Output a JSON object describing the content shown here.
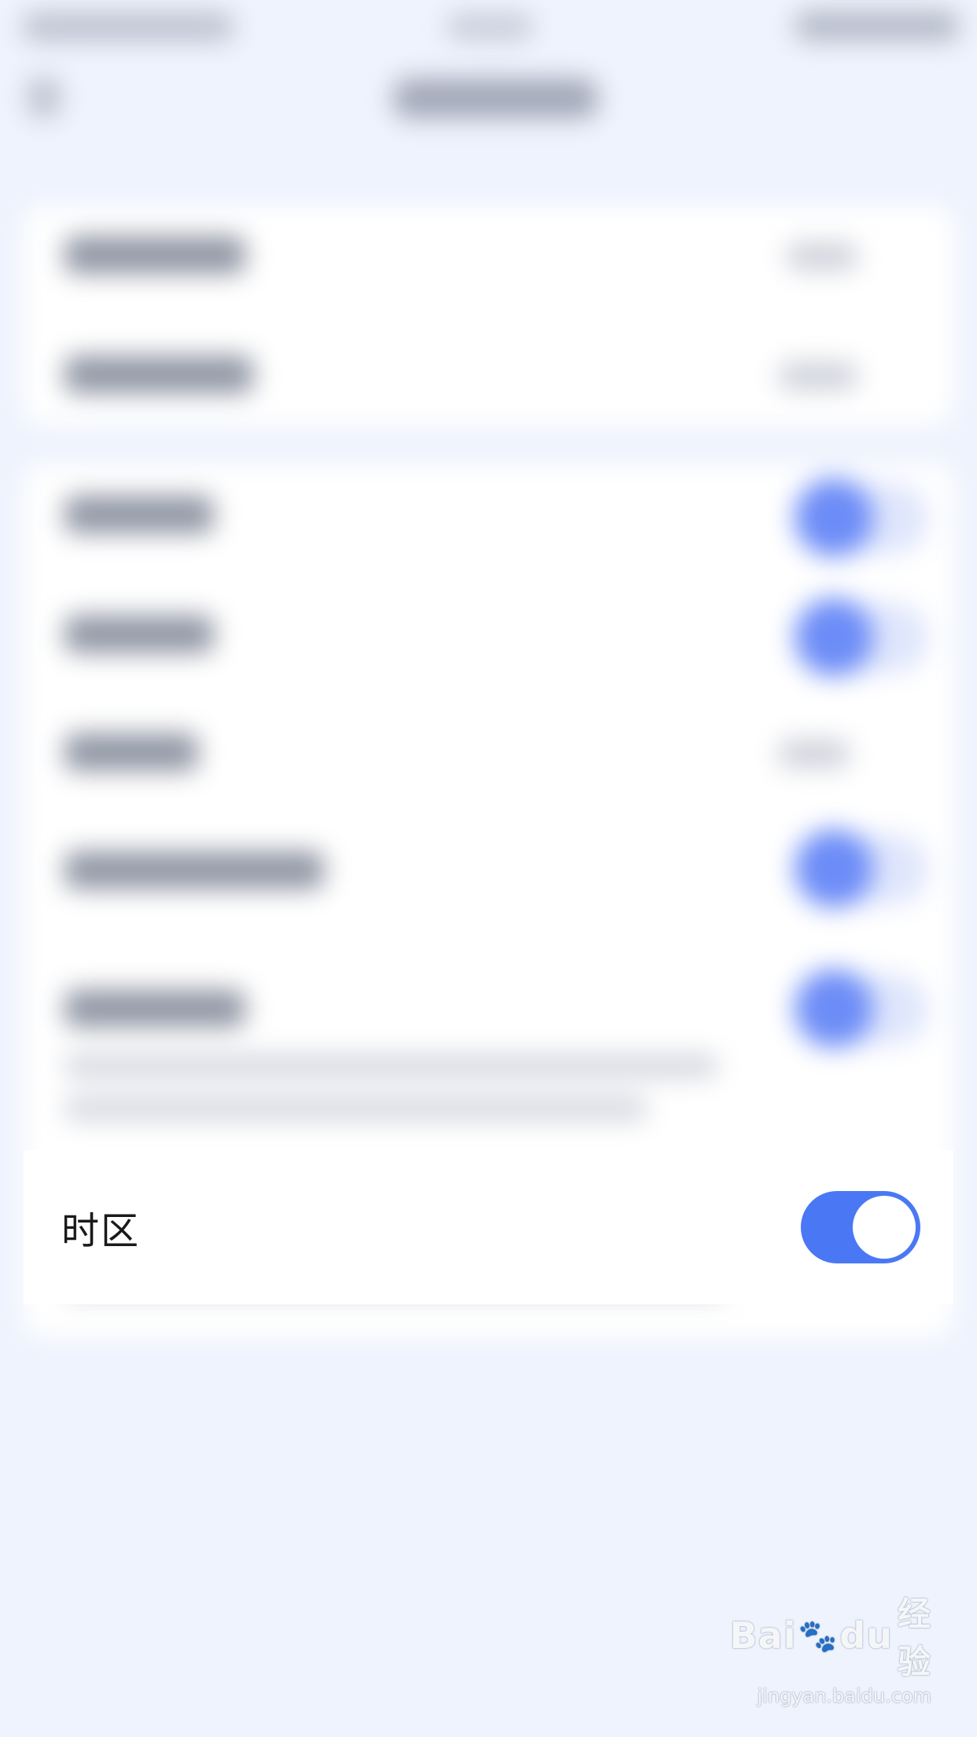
{
  "setting_row": {
    "label": "时区",
    "toggle_on": true
  },
  "colors": {
    "background": "#eff3fd",
    "card": "#ffffff",
    "toggle_on": "#4a78f5",
    "text": "#1a1a1a"
  },
  "icons": {
    "watermark_logo": "baidu-paw-icon"
  },
  "watermark": {
    "brand_left": "Bai",
    "brand_right": "du",
    "brand_cn": "经验",
    "url": "jingyan.baidu.com"
  }
}
